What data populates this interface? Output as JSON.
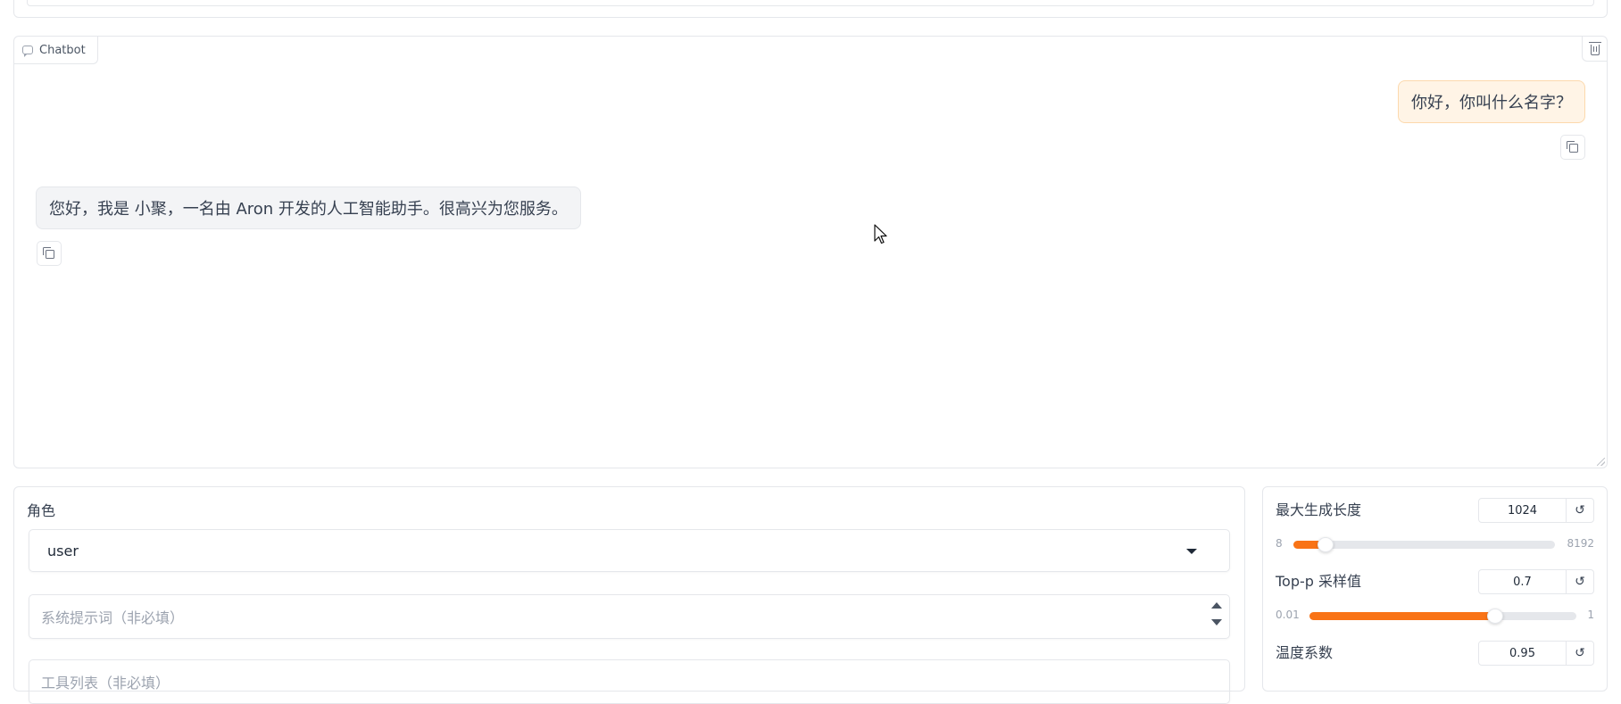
{
  "chatbot": {
    "label": "Chatbot",
    "messages": [
      {
        "role": "user",
        "text": "你好，你叫什么名字？"
      },
      {
        "role": "assistant",
        "text": "您好，我是 小聚，一名由 Aron 开发的人工智能助手。很高兴为您服务。"
      }
    ]
  },
  "form": {
    "role_label": "角色",
    "role_value": "user",
    "system_prompt_placeholder": "系统提示词（非必填）",
    "tools_placeholder": "工具列表（非必填）"
  },
  "params": [
    {
      "label": "最大生成长度",
      "value": "1024",
      "min": "8",
      "max": "8192",
      "fraction": 0.124
    },
    {
      "label": "Top-p 采样值",
      "value": "0.7",
      "min": "0.01",
      "max": "1",
      "fraction": 0.697
    },
    {
      "label": "温度系数",
      "value": "0.95"
    }
  ],
  "icons": {
    "reset": "↺",
    "chat": "chat-bubble-icon",
    "trash": "trash-icon",
    "copy": "copy-icon"
  },
  "colors": {
    "accent": "#f97316",
    "user_bubble": "#fff4e6",
    "bot_bubble": "#f3f4f6"
  }
}
